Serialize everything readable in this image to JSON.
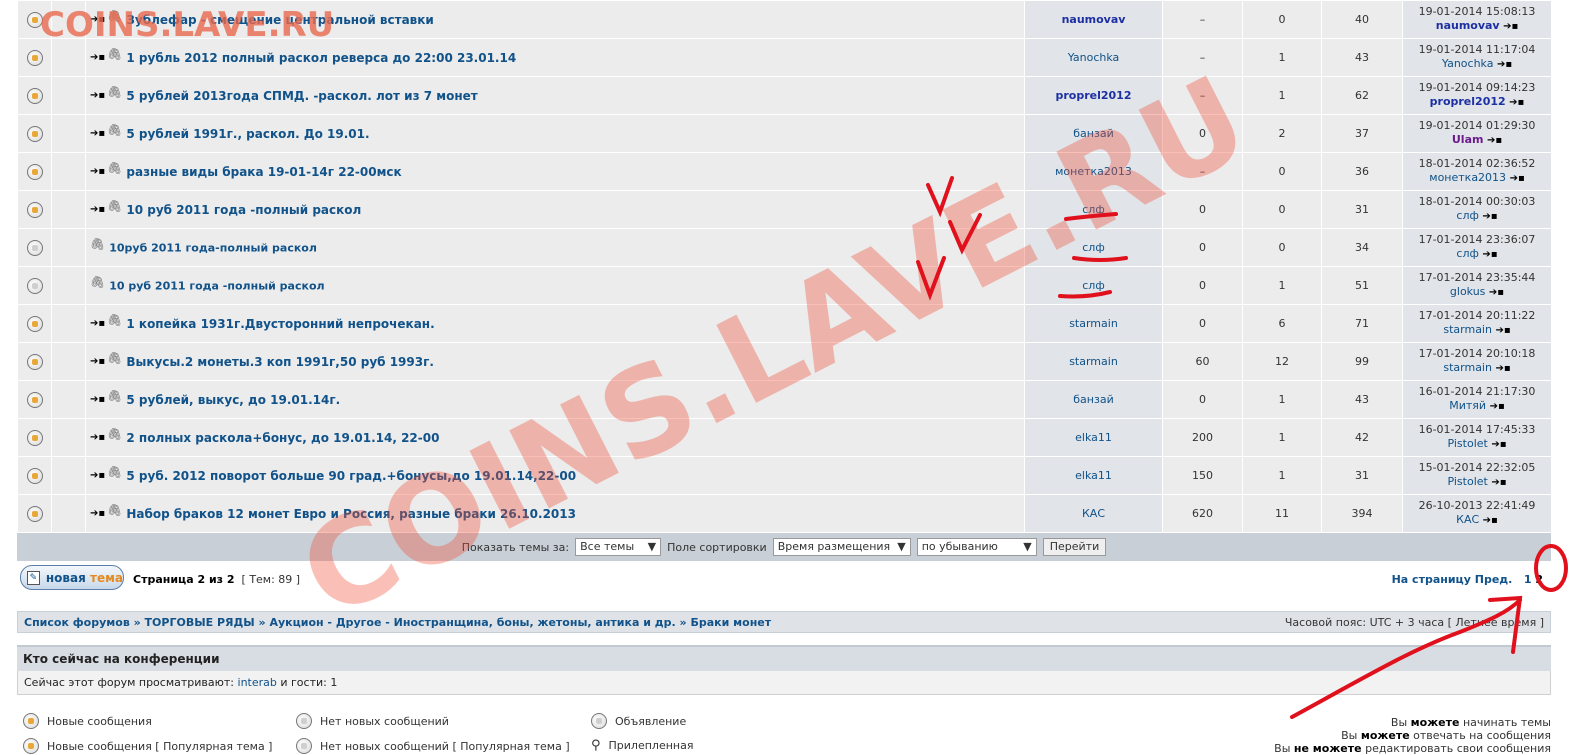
{
  "topics": [
    {
      "title": "Зублефар - смещение центральной вставки",
      "author": "naumovav",
      "author_bold": true,
      "col1": "–",
      "replies": "0",
      "views": "40",
      "last_date": "19-01-2014 15:08:13",
      "last_user": "naumovav",
      "last_bold": true,
      "goto": true
    },
    {
      "title": "1 рубль 2012 полный раскол реверса до 22:00 23.01.14",
      "author": "Yanochka",
      "col1": "–",
      "replies": "1",
      "views": "43",
      "last_date": "19-01-2014 11:17:04",
      "last_user": "Yanochka",
      "goto": true
    },
    {
      "title": "5 рублей 2013года СПМД. -раскол. лот из 7 монет",
      "author": "proprel2012",
      "author_bold": true,
      "col1": "–",
      "replies": "1",
      "views": "62",
      "last_date": "19-01-2014 09:14:23",
      "last_user": "proprel2012",
      "last_bold": true,
      "goto": true
    },
    {
      "title": "5 рублей 1991г., раскол. До 19.01.",
      "author": "банзай",
      "col1": "0",
      "replies": "2",
      "views": "37",
      "last_date": "19-01-2014 01:29:30",
      "last_user": "Ulam",
      "last_purple": true,
      "goto": true
    },
    {
      "title": "разные виды брака 19-01-14г 22-00мск",
      "author": "монетка2013",
      "col1": "–",
      "replies": "0",
      "views": "36",
      "last_date": "18-01-2014 02:36:52",
      "last_user": "монетка2013",
      "goto": true
    },
    {
      "title": "10 руб 2011 года -полный раскол",
      "author": "слф",
      "col1": "0",
      "replies": "0",
      "views": "31",
      "last_date": "18-01-2014 00:30:03",
      "last_user": "слф",
      "goto": true
    },
    {
      "title": "10руб 2011 года-полный раскол",
      "author": "слф",
      "col1": "0",
      "replies": "0",
      "views": "34",
      "last_date": "17-01-2014 23:36:07",
      "last_user": "слф",
      "goto": false,
      "small": true
    },
    {
      "title": "10 руб 2011 года -полный раскол",
      "author": "слф",
      "col1": "0",
      "replies": "1",
      "views": "51",
      "last_date": "17-01-2014 23:35:44",
      "last_user": "glokus",
      "goto": false,
      "small": true
    },
    {
      "title": "1 копейка 1931г.Двусторонний непрочекан.",
      "author": "starmain",
      "col1": "0",
      "replies": "6",
      "views": "71",
      "last_date": "17-01-2014 20:11:22",
      "last_user": "starmain",
      "goto": true
    },
    {
      "title": "Выкусы.2 монеты.3 коп 1991г,50 руб 1993г.",
      "author": "starmain",
      "col1": "60",
      "replies": "12",
      "views": "99",
      "last_date": "17-01-2014 20:10:18",
      "last_user": "starmain",
      "goto": true
    },
    {
      "title": "5 рублей, выкус, до 19.01.14г.",
      "author": "банзай",
      "col1": "0",
      "replies": "1",
      "views": "43",
      "last_date": "16-01-2014 21:17:30",
      "last_user": "Митяй",
      "goto": true
    },
    {
      "title": "2 полных раскола+бонус, до 19.01.14, 22-00",
      "author": "elka11",
      "col1": "200",
      "replies": "1",
      "views": "42",
      "last_date": "16-01-2014 17:45:33",
      "last_user": "Pistolet",
      "goto": true
    },
    {
      "title": "5 руб. 2012 поворот больше 90 град.+бонусы,до 19.01.14,22-00",
      "author": "elka11",
      "col1": "150",
      "replies": "1",
      "views": "31",
      "last_date": "15-01-2014 22:32:05",
      "last_user": "Pistolet",
      "goto": true
    },
    {
      "title": "Набор браков 12 монет Евро и Россия, разные браки 26.10.2013",
      "author": "КАС",
      "col1": "620",
      "replies": "11",
      "views": "394",
      "last_date": "26-10-2013 22:41:49",
      "last_user": "КАС",
      "goto": true
    }
  ],
  "sortbar": {
    "show_label": "Показать темы за:",
    "show_value": "Все темы",
    "sort_label": "Поле сортировки",
    "sort_value": "Время размещения",
    "order_value": "по убыванию",
    "go_label": "Перейти"
  },
  "pager": {
    "new_topic_a": "новая",
    "new_topic_b": "тема",
    "page_text": "Страница 2 из 2",
    "topics_count": "[ Тем: 89 ]",
    "goto_label": "На страницу",
    "prev_label": "Пред.",
    "page1": "1",
    "page2": "2"
  },
  "breadcrumbs": {
    "trail": "Список форумов » ТОРГОВЫЕ РЯДЫ » Аукцион - Другое - Иностранщина, боны, жетоны, антика и др. » Браки монет",
    "timezone": "Часовой пояс: UTC + 3 часа [ Летнее время ]"
  },
  "who": {
    "heading": "Кто сейчас на конференции",
    "text_before": "Сейчас этот форум просматривают:",
    "user": "interab",
    "text_after": "и гости: 1"
  },
  "legend": {
    "new_posts": "Новые сообщения",
    "new_posts_popular": "Новые сообщения [ Популярная тема ]",
    "no_new_posts": "Нет новых сообщений",
    "no_new_posts_popular": "Нет новых сообщений [ Популярная тема ]",
    "announcement": "Объявление",
    "sticky": "Прилепленная"
  },
  "permissions": {
    "line1_a": "Вы",
    "line1_b": "можете",
    "line1_c": "начинать темы",
    "line2_a": "Вы",
    "line2_b": "можете",
    "line2_c": "отвечать на сообщения",
    "line3_a": "Вы",
    "line3_b": "не можете",
    "line3_c": "редактировать свои сообщения"
  },
  "watermark": {
    "corner": "COINS.LAVE.RU",
    "diagonal": "COINS.LAVE.RU"
  }
}
